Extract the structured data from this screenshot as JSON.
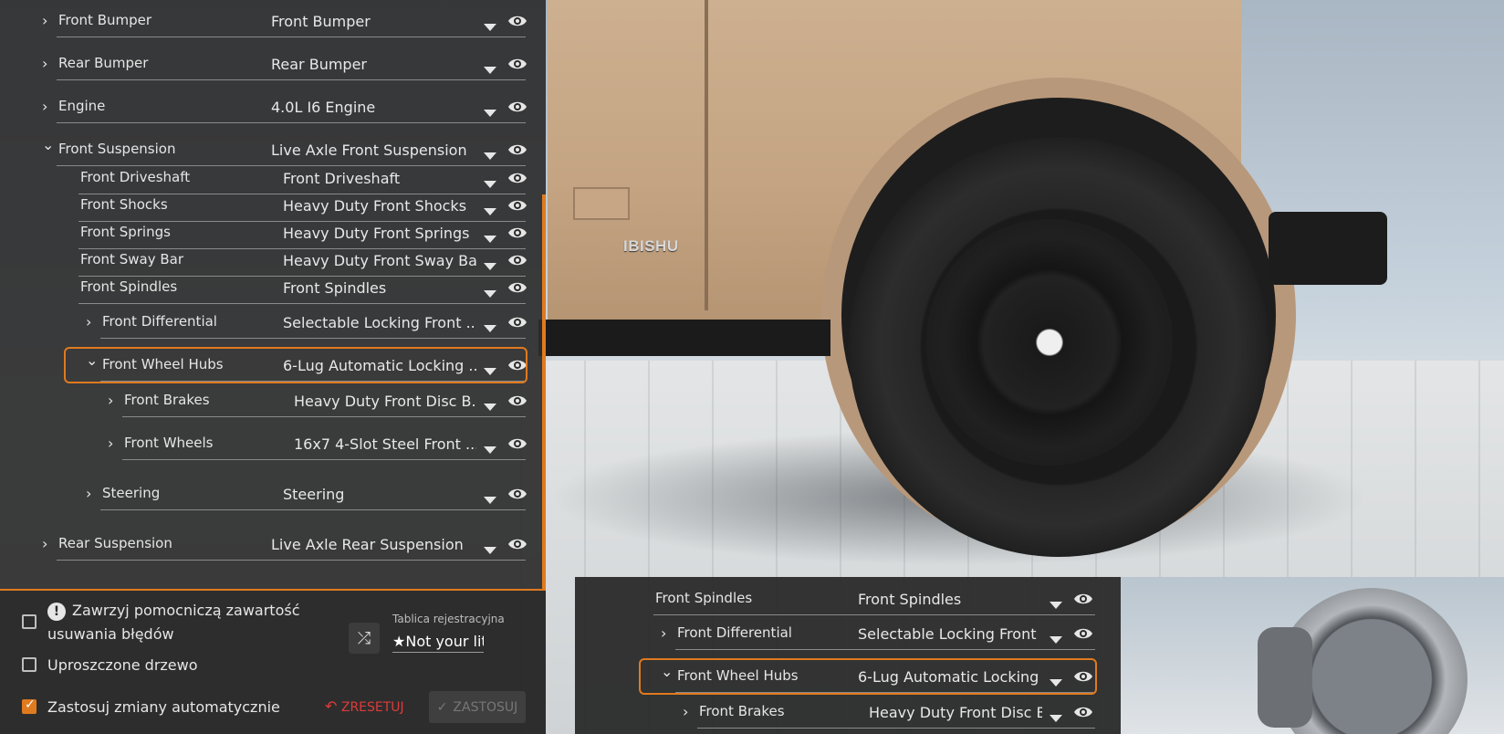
{
  "scene": {
    "badge": "IBISHU"
  },
  "tree": {
    "rows": [
      {
        "label": "Front Bumper",
        "value": "Front Bumper",
        "chevron": "right"
      },
      {
        "label": "Rear Bumper",
        "value": "Rear Bumper",
        "chevron": "right"
      },
      {
        "label": "Engine",
        "value": "4.0L I6 Engine",
        "chevron": "right"
      },
      {
        "label": "Front Suspension",
        "value": "Live Axle Front Suspension",
        "chevron": "down"
      },
      {
        "label": "Front Driveshaft",
        "value": "Front Driveshaft",
        "chevron": ""
      },
      {
        "label": "Front Shocks",
        "value": "Heavy Duty Front Shocks",
        "chevron": ""
      },
      {
        "label": "Front Springs",
        "value": "Heavy Duty Front Springs",
        "chevron": ""
      },
      {
        "label": "Front Sway Bar",
        "value": "Heavy Duty Front Sway Bar",
        "chevron": ""
      },
      {
        "label": "Front Spindles",
        "value": "Front Spindles",
        "chevron": ""
      },
      {
        "label": "Front Differential",
        "value": "Selectable Locking Front ...",
        "chevron": "right"
      },
      {
        "label": "Front Wheel Hubs",
        "value": "6-Lug Automatic Locking ...",
        "chevron": "down"
      },
      {
        "label": "Front Brakes",
        "value": "Heavy Duty Front Disc B...",
        "chevron": "right"
      },
      {
        "label": "Front Wheels",
        "value": "16x7 4-Slot Steel Front ...",
        "chevron": "right"
      },
      {
        "label": "Steering",
        "value": "Steering",
        "chevron": "right"
      },
      {
        "label": "Rear Suspension",
        "value": "Live Axle Rear Suspension",
        "chevron": "right"
      }
    ]
  },
  "options": {
    "debug_label": "Zawrzyj pomocniczą zawartość",
    "debug_label2": "usuwania błędów",
    "debug_checked": false,
    "simple_tree_label": "Uproszczone drzewo",
    "simple_tree_checked": false,
    "auto_apply_label": "Zastosuj zmiany automatycznie",
    "auto_apply_checked": true,
    "plate_label": "Tablica rejestracyjna",
    "plate_value": "★Not your littl",
    "reset_label": "ZRESETUJ",
    "apply_label": "ZASTOSUJ"
  },
  "inset": {
    "rows": [
      {
        "label": "Front Spindles",
        "value": "Front Spindles",
        "chevron": ""
      },
      {
        "label": "Front Differential",
        "value": "Selectable Locking Front ...",
        "chevron": "right"
      },
      {
        "label": "Front Wheel Hubs",
        "value": "6-Lug Automatic Locking ...",
        "chevron": "down"
      },
      {
        "label": "Front Brakes",
        "value": "Heavy Duty Front Disc B...",
        "chevron": "right"
      }
    ]
  },
  "colors": {
    "accent": "#e07a1f",
    "reset": "#e03a3a"
  }
}
